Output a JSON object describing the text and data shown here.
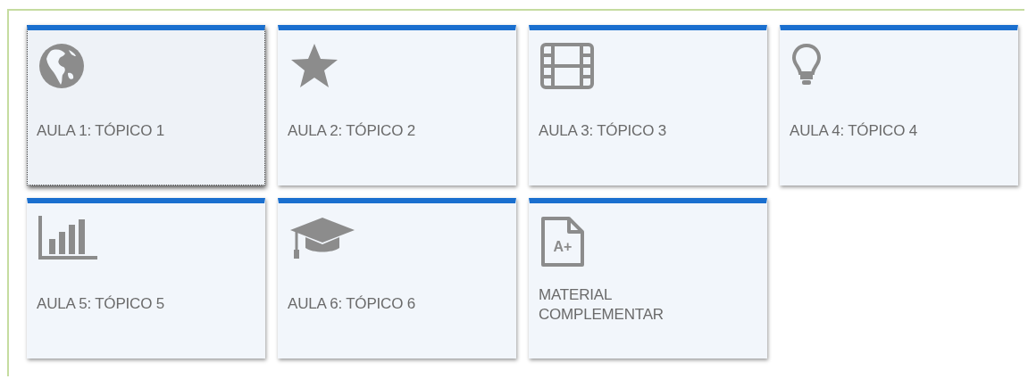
{
  "cards": [
    {
      "title": "AULA 1: TÓPICO 1",
      "focused": true
    },
    {
      "title": "AULA 2: TÓPICO 2",
      "focused": false
    },
    {
      "title": "AULA 3: TÓPICO 3",
      "focused": false
    },
    {
      "title": "AULA 4: TÓPICO 4",
      "focused": false
    },
    {
      "title": "AULA 5: TÓPICO 5",
      "focused": false
    },
    {
      "title": "AULA 6: TÓPICO 6",
      "focused": false
    },
    {
      "title": "MATERIAL COMPLEMENTAR",
      "icon_label": "A+",
      "focused": false
    }
  ]
}
